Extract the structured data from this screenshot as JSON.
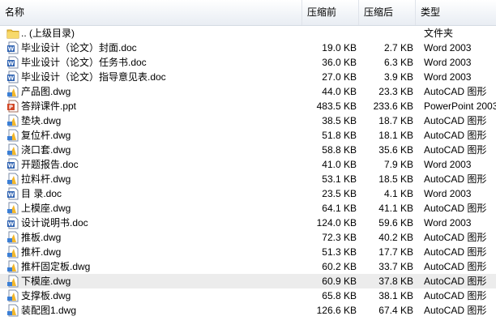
{
  "header": {
    "name_label": "名称",
    "original_label": "压缩前",
    "compressed_label": "压缩后",
    "type_label": "类型"
  },
  "rows": [
    {
      "name": ".. (上级目录)",
      "original": "",
      "compressed": "",
      "type": "文件夹",
      "icon": "folder-up-icon"
    },
    {
      "name": "毕业设计（论文）封面.doc",
      "original": "19.0 KB",
      "compressed": "2.7 KB",
      "type": "Word 2003",
      "icon": "word-doc-icon"
    },
    {
      "name": "毕业设计（论文）任务书.doc",
      "original": "36.0 KB",
      "compressed": "6.3 KB",
      "type": "Word 2003",
      "icon": "word-doc-icon"
    },
    {
      "name": "毕业设计（论文）指导意见表.doc",
      "original": "27.0 KB",
      "compressed": "3.9 KB",
      "type": "Word 2003",
      "icon": "word-doc-icon"
    },
    {
      "name": "产品图.dwg",
      "original": "44.0 KB",
      "compressed": "23.3 KB",
      "type": "AutoCAD 图形",
      "icon": "autocad-dwg-icon"
    },
    {
      "name": "答辩课件.ppt",
      "original": "483.5 KB",
      "compressed": "233.6 KB",
      "type": "PowerPoint 2003",
      "icon": "powerpoint-icon"
    },
    {
      "name": "垫块.dwg",
      "original": "38.5 KB",
      "compressed": "18.7 KB",
      "type": "AutoCAD 图形",
      "icon": "autocad-dwg-icon"
    },
    {
      "name": "复位杆.dwg",
      "original": "51.8 KB",
      "compressed": "18.1 KB",
      "type": "AutoCAD 图形",
      "icon": "autocad-dwg-icon"
    },
    {
      "name": "浇口套.dwg",
      "original": "58.8 KB",
      "compressed": "35.6 KB",
      "type": "AutoCAD 图形",
      "icon": "autocad-dwg-icon"
    },
    {
      "name": "开题报告.doc",
      "original": "41.0 KB",
      "compressed": "7.9 KB",
      "type": "Word 2003",
      "icon": "word-doc-icon"
    },
    {
      "name": "拉料杆.dwg",
      "original": "53.1 KB",
      "compressed": "18.5 KB",
      "type": "AutoCAD 图形",
      "icon": "autocad-dwg-icon"
    },
    {
      "name": "目  录.doc",
      "original": "23.5 KB",
      "compressed": "4.1 KB",
      "type": "Word 2003",
      "icon": "word-doc-icon"
    },
    {
      "name": "上模座.dwg",
      "original": "64.1 KB",
      "compressed": "41.1 KB",
      "type": "AutoCAD 图形",
      "icon": "autocad-dwg-icon"
    },
    {
      "name": "设计说明书.doc",
      "original": "124.0 KB",
      "compressed": "59.6 KB",
      "type": "Word 2003",
      "icon": "word-doc-icon"
    },
    {
      "name": "推板.dwg",
      "original": "72.3 KB",
      "compressed": "40.2 KB",
      "type": "AutoCAD 图形",
      "icon": "autocad-dwg-icon"
    },
    {
      "name": "推杆.dwg",
      "original": "51.3 KB",
      "compressed": "17.7 KB",
      "type": "AutoCAD 图形",
      "icon": "autocad-dwg-icon"
    },
    {
      "name": "推杆固定板.dwg",
      "original": "60.2 KB",
      "compressed": "33.7 KB",
      "type": "AutoCAD 图形",
      "icon": "autocad-dwg-icon"
    },
    {
      "name": "下模座.dwg",
      "original": "60.9 KB",
      "compressed": "37.8 KB",
      "type": "AutoCAD 图形",
      "icon": "autocad-dwg-icon",
      "selected": true
    },
    {
      "name": "支撑板.dwg",
      "original": "65.8 KB",
      "compressed": "38.1 KB",
      "type": "AutoCAD 图形",
      "icon": "autocad-dwg-icon"
    },
    {
      "name": "装配图1.dwg",
      "original": "126.6 KB",
      "compressed": "67.4 KB",
      "type": "AutoCAD 图形",
      "icon": "autocad-dwg-icon"
    }
  ],
  "colors": {
    "selected_row": "#ececec",
    "folder": "#f2c94c",
    "word": "#2a5fb0",
    "powerpoint": "#d24726",
    "autocad": "#3b7fd6"
  }
}
